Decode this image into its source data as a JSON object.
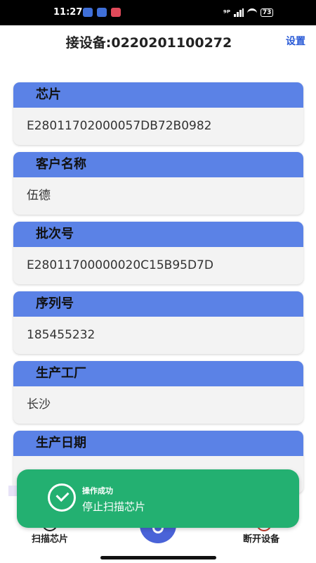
{
  "status_bar": {
    "time": "11:27",
    "indicators": "⁹ᴾ",
    "battery": "73"
  },
  "header": {
    "title": "接设备:0220201100272",
    "settings_label": "设置"
  },
  "fields": [
    {
      "label": "芯片",
      "value": "E28011702000057DB72B0982"
    },
    {
      "label": "客户名称",
      "value": "伍德"
    },
    {
      "label": "批次号",
      "value": "E28011700000020C15B95D7D"
    },
    {
      "label": "序列号",
      "value": "185455232"
    },
    {
      "label": "生产工厂",
      "value": "长沙"
    },
    {
      "label": "生产日期",
      "value": ""
    }
  ],
  "bottom_nav": {
    "scan_label": "扫描芯片",
    "disconnect_label": "断开设备"
  },
  "toast": {
    "title": "操作成功",
    "message": "停止扫描芯片"
  },
  "colors": {
    "card_header": "#5b82e6",
    "toast": "#23b071",
    "link": "#2a5bd7"
  }
}
